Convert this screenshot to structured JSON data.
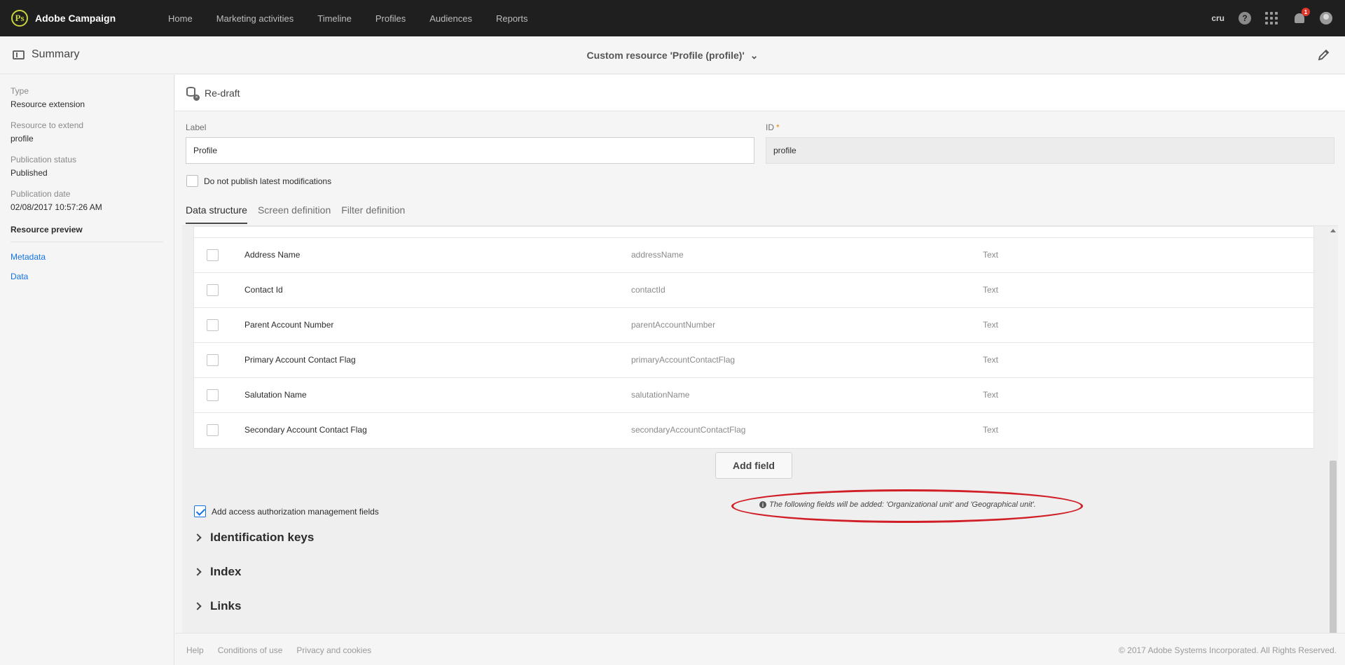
{
  "app": {
    "name": "Adobe Campaign",
    "logo_glyph": "Ps"
  },
  "nav": [
    "Home",
    "Marketing activities",
    "Timeline",
    "Profiles",
    "Audiences",
    "Reports"
  ],
  "top_right": {
    "user_code": "cru",
    "help_glyph": "?",
    "notification_count": "1"
  },
  "subheader": {
    "summary": "Summary",
    "resource_title": "Custom resource 'Profile (profile)'",
    "chevron": "⌄"
  },
  "sidebar": {
    "type_label": "Type",
    "type_value": "Resource extension",
    "extend_label": "Resource to extend",
    "extend_value": "profile",
    "status_label": "Publication status",
    "status_value": "Published",
    "date_label": "Publication date",
    "date_value": "02/08/2017 10:57:26 AM",
    "preview": "Resource preview",
    "links": [
      "Metadata",
      "Data"
    ]
  },
  "toolbar": {
    "redraft": "Re-draft"
  },
  "form": {
    "label_label": "Label",
    "label_value": "Profile",
    "id_label": "ID",
    "id_required": "*",
    "id_value": "profile",
    "do_not_publish": "Do not publish latest modifications"
  },
  "tabs": [
    "Data structure",
    "Screen definition",
    "Filter definition"
  ],
  "fields": [
    {
      "label": "Address Name",
      "id": "addressName",
      "type": "Text"
    },
    {
      "label": "Contact Id",
      "id": "contactId",
      "type": "Text"
    },
    {
      "label": "Parent Account Number",
      "id": "parentAccountNumber",
      "type": "Text"
    },
    {
      "label": "Primary Account Contact Flag",
      "id": "primaryAccountContactFlag",
      "type": "Text"
    },
    {
      "label": "Salutation Name",
      "id": "salutationName",
      "type": "Text"
    },
    {
      "label": "Secondary Account Contact Flag",
      "id": "secondaryAccountContactFlag",
      "type": "Text"
    }
  ],
  "add_field": "Add field",
  "access_auth": "Add access authorization management fields",
  "info_message": "The following fields will be added: 'Organizational unit' and 'Geographical unit'.",
  "sections": [
    "Identification keys",
    "Index",
    "Links"
  ],
  "footer": {
    "links": [
      "Help",
      "Conditions of use",
      "Privacy and cookies"
    ],
    "copyright": "© 2017 Adobe Systems Incorporated. All Rights Reserved."
  },
  "colors": {
    "topbar": "#1f1f1f",
    "logo": "#c9d33d",
    "link": "#1473e6",
    "required": "#e68619",
    "annotation": "#d01f26"
  }
}
